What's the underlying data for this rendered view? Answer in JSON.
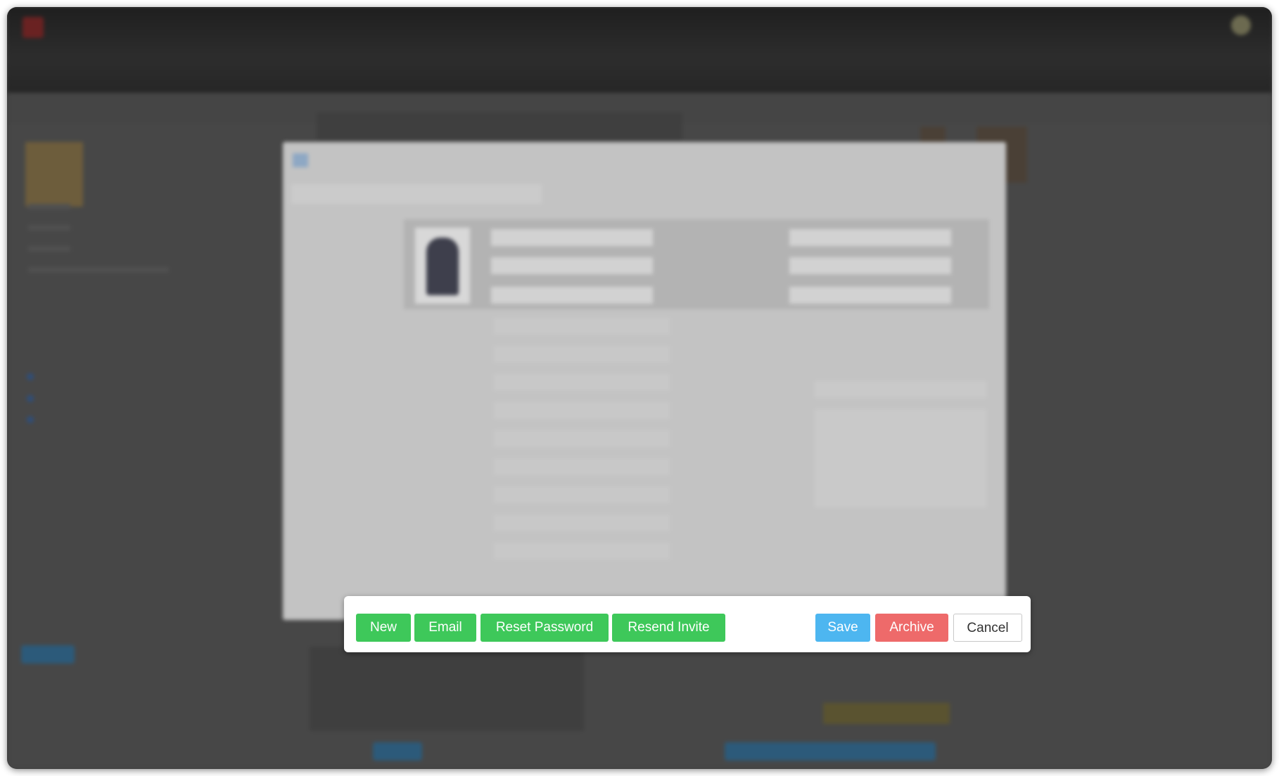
{
  "action_bar": {
    "left_buttons": [
      "New",
      "Email",
      "Reset Password",
      "Resend Invite"
    ],
    "save_label": "Save",
    "archive_label": "Archive",
    "cancel_label": "Cancel"
  },
  "colors": {
    "success": "#3ec85a",
    "primary": "#4db6f0",
    "danger": "#ee6a6a"
  }
}
